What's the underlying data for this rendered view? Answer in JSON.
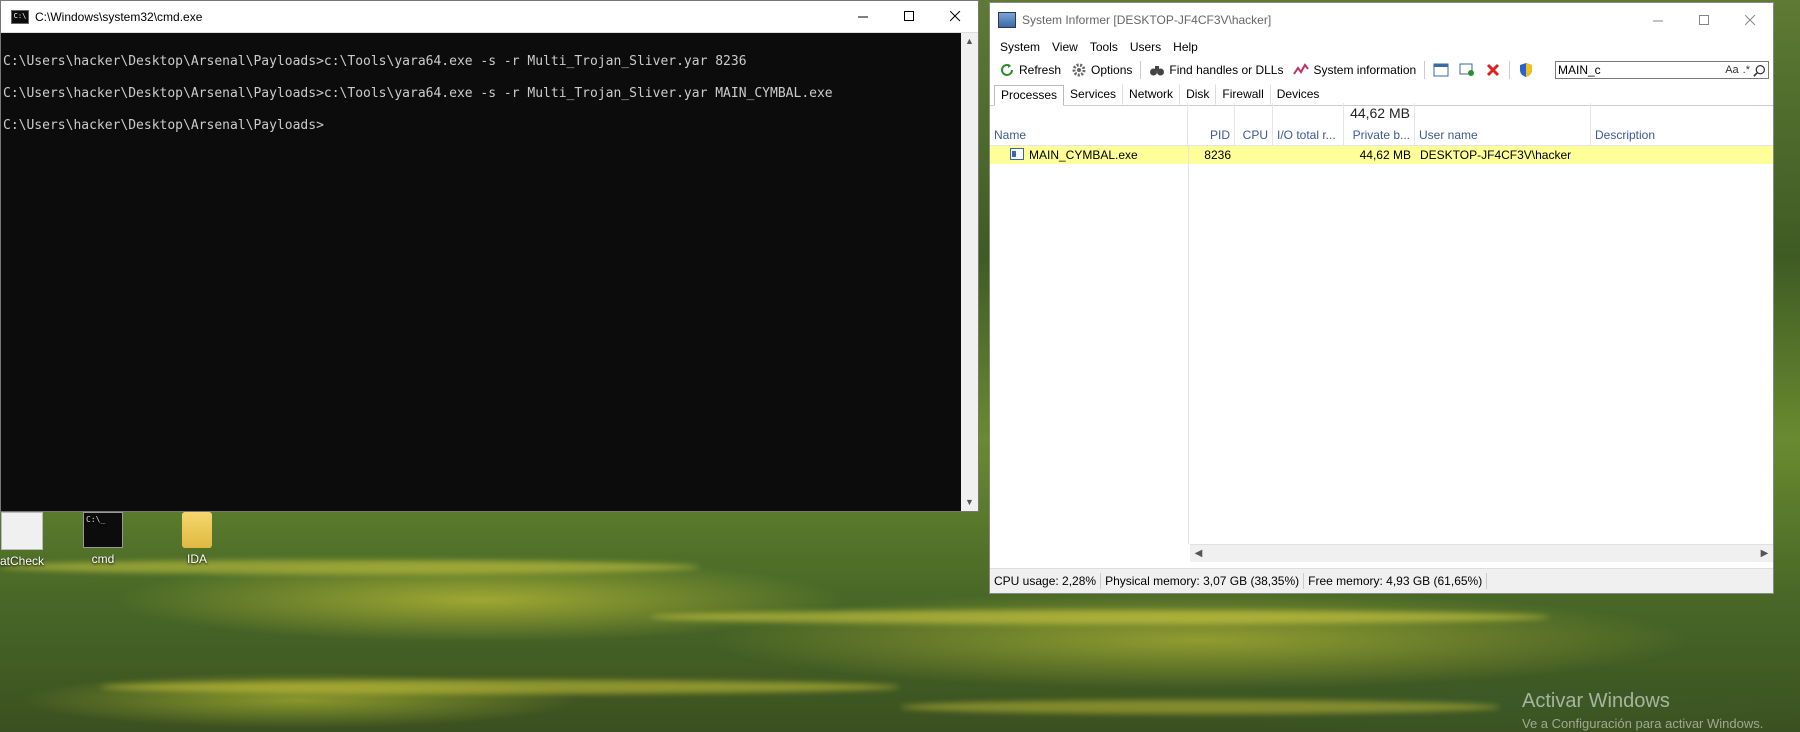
{
  "desktop": {
    "icons": [
      {
        "label": "atCheck"
      },
      {
        "label": "cmd"
      },
      {
        "label": "IDA"
      }
    ],
    "watermark_title": "Activar Windows",
    "watermark_sub": "Ve a Configuración para activar Windows."
  },
  "cmd": {
    "title": "C:\\Windows\\system32\\cmd.exe",
    "lines": [
      "C:\\Users\\hacker\\Desktop\\Arsenal\\Payloads>c:\\Tools\\yara64.exe -s -r Multi_Trojan_Sliver.yar 8236",
      "",
      "C:\\Users\\hacker\\Desktop\\Arsenal\\Payloads>c:\\Tools\\yara64.exe -s -r Multi_Trojan_Sliver.yar MAIN_CYMBAL.exe",
      "",
      "C:\\Users\\hacker\\Desktop\\Arsenal\\Payloads>"
    ]
  },
  "si": {
    "title": "System Informer [DESKTOP-JF4CF3V\\hacker]",
    "menu": [
      "System",
      "View",
      "Tools",
      "Users",
      "Help"
    ],
    "toolbar": {
      "refresh": "Refresh",
      "options": "Options",
      "find_handles": "Find handles or DLLs",
      "system_info": "System information"
    },
    "search": {
      "value": "MAIN_c",
      "case_label": "Aa",
      "regex_label": ".*"
    },
    "tabs": [
      "Processes",
      "Services",
      "Network",
      "Disk",
      "Firewall",
      "Devices"
    ],
    "active_tab": "Processes",
    "columns": {
      "name": "Name",
      "pid": "PID",
      "cpu": "CPU",
      "io": "I/O total r...",
      "private": "Private b...",
      "private_total": "44,62 MB",
      "user": "User name",
      "description": "Description"
    },
    "rows": [
      {
        "name": "MAIN_CYMBAL.exe",
        "pid": "8236",
        "cpu": "",
        "io": "",
        "private": "44,62 MB",
        "user": "DESKTOP-JF4CF3V\\hacker",
        "description": ""
      }
    ],
    "status": {
      "cpu": "CPU usage: 2,28%",
      "phys": "Physical memory: 3,07 GB (38,35%)",
      "free": "Free memory: 4,93 GB (61,65%)"
    },
    "colors": {
      "row_highlight": "#ffff99",
      "header_text": "#3c5a96"
    }
  }
}
